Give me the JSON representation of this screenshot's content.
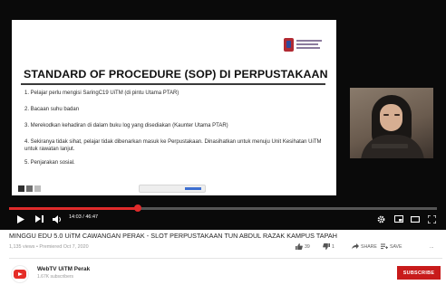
{
  "player": {
    "slide": {
      "title": "STANDARD OF PROCEDURE (SOP) DI PERPUSTAKAAN",
      "items": [
        "1. Pelajar perlu mengisi SaringC19 UiTM (di pintu Utama PTAR)",
        "2. Bacaan suhu badan",
        "3. Merekodkan kehadiran di dalam buku log yang disediakan (Kaunter Utama PTAR)",
        "4. Sekiranya tidak sihat, pelajar tidak dibenarkan masuk ke Perpustakaan.  Dinasihatkan untuk menuju Unit Kesihatan UiTM untuk rawatan lanjut.",
        "5. Penjarakan sosial."
      ]
    },
    "progress_fraction": 0.3,
    "time": "14:03 / 46:47",
    "icons": {
      "play": "play-icon",
      "next": "next-icon",
      "volume": "volume-icon",
      "settings": "settings-gear-icon",
      "miniplayer": "miniplayer-icon",
      "theater": "theater-mode-icon",
      "fullscreen": "fullscreen-icon"
    },
    "accent_color": "#e02b2b"
  },
  "video": {
    "title": "MINGGU EDU 5.0 UiTM CAWANGAN PERAK - SLOT PERPUSTAKAAN TUN ABDUL RAZAK KAMPUS TAPAH",
    "meta": "1,135 views • Premiered Oct 7, 2020",
    "actions": {
      "like": "39",
      "dislike": "1",
      "share": "SHARE",
      "save": "SAVE",
      "more": "..."
    }
  },
  "channel": {
    "name": "WebTV UiTM Perak",
    "subscribers": "1.67K subscribers",
    "subscribe_label": "SUBSCRIBE",
    "subscribe_color": "#c81b1b"
  }
}
